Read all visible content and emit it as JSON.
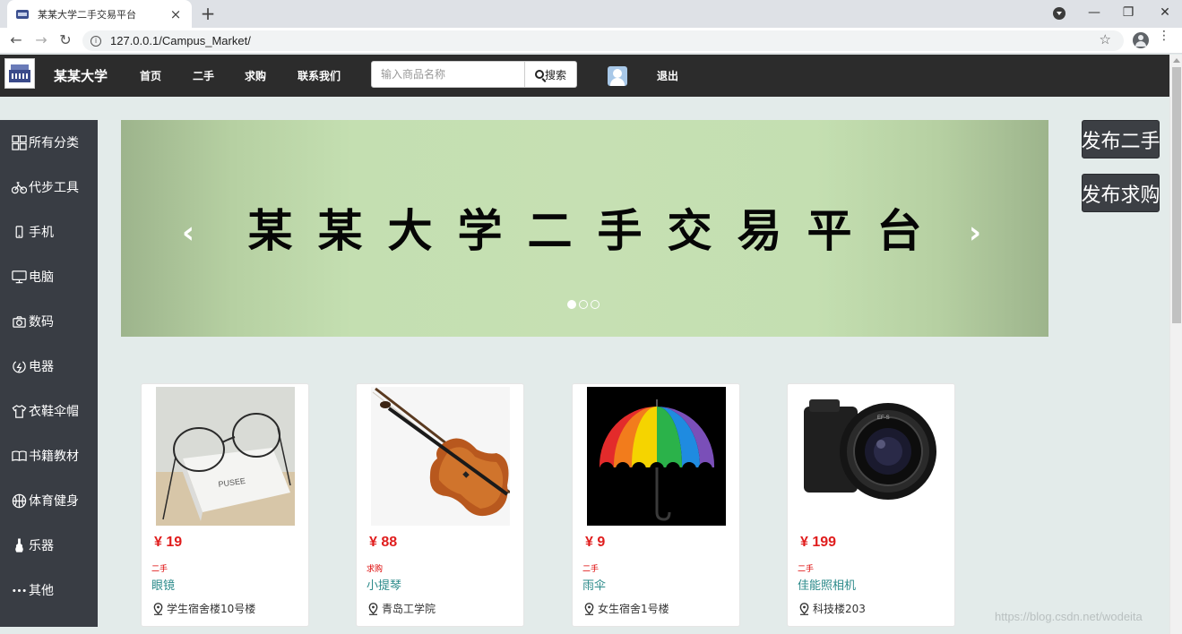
{
  "browser": {
    "tab_title": "某某大学二手交易平台",
    "tab_close": "×",
    "new_tab": "+",
    "url": "127.0.0.1/Campus_Market/",
    "info_glyph": "i",
    "star_glyph": "☆",
    "back_glyph": "←",
    "forward_glyph": "→",
    "reload_glyph": "↻",
    "minimize_glyph": "—",
    "restore_glyph": "❐",
    "close_glyph": "✕",
    "menu_glyph": "⋮"
  },
  "site": {
    "brand": "某某大学",
    "nav": [
      "首页",
      "二手",
      "求购",
      "联系我们"
    ],
    "search_placeholder": "输入商品名称",
    "search_button": "搜索",
    "logout": "退出"
  },
  "sidebar": {
    "items": [
      {
        "label": "所有分类",
        "icon": "grid-icon"
      },
      {
        "label": "代步工具",
        "icon": "bicycle-icon"
      },
      {
        "label": "手机",
        "icon": "phone-icon"
      },
      {
        "label": "电脑",
        "icon": "monitor-icon"
      },
      {
        "label": "数码",
        "icon": "camera-icon"
      },
      {
        "label": "电器",
        "icon": "plug-icon"
      },
      {
        "label": "衣鞋伞帽",
        "icon": "shirt-icon"
      },
      {
        "label": "书籍教材",
        "icon": "book-icon"
      },
      {
        "label": "体育健身",
        "icon": "ball-icon"
      },
      {
        "label": "乐器",
        "icon": "instrument-icon"
      },
      {
        "label": "其他",
        "icon": "more-icon"
      }
    ]
  },
  "banner": {
    "text": "某某大学二手交易平台",
    "prev": "‹",
    "next": "›",
    "slides": 3,
    "active_slide": 1
  },
  "actions": {
    "post_secondhand": "发布二手",
    "post_wanted": "发布求购"
  },
  "products": [
    {
      "price": "¥ 19",
      "tag": "二手",
      "name": "眼镜",
      "location": "学生宿舍楼10号楼",
      "image": "glasses"
    },
    {
      "price": "¥ 88",
      "tag": "求购",
      "name": "小提琴",
      "location": "青岛工学院",
      "image": "violin"
    },
    {
      "price": "¥ 9",
      "tag": "二手",
      "name": "雨伞",
      "location": "女生宿舍1号楼",
      "image": "umbrella"
    },
    {
      "price": "¥ 199",
      "tag": "二手",
      "name": "佳能照相机",
      "location": "科技楼203",
      "image": "camera"
    }
  ],
  "watermark": "https://blog.csdn.net/wodeita"
}
